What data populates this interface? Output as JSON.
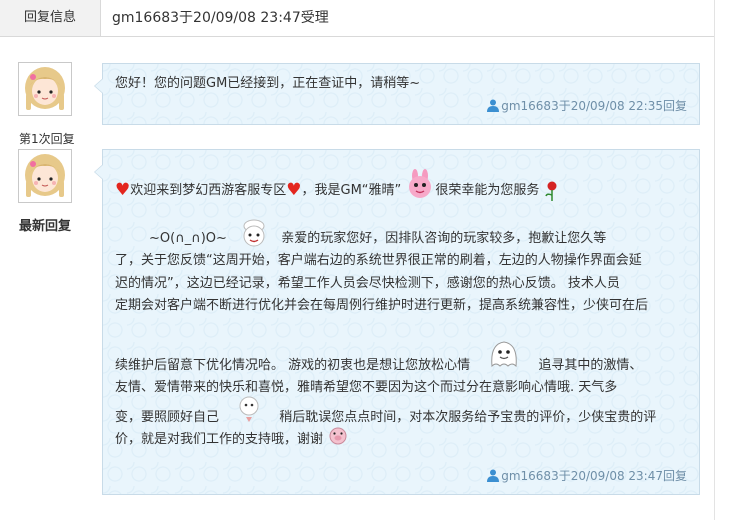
{
  "header": {
    "label": "回复信息",
    "value": "gm16683于20/09/08 23:47受理"
  },
  "replies": [
    {
      "side_label": "第1次回复",
      "text": "您好！您的问题GM已经接到，正在查证中，请稍等~",
      "meta": "gm16683于20/09/08 22:35回复"
    },
    {
      "side_label": "最新回复",
      "line1_a": "欢迎来到梦幻西游客服专区",
      "line1_b": "，我是GM“雅晴”",
      "line1_c": "很荣幸能为您服务",
      "line2_a": "~O(∩_∩)O~",
      "line2_b": "亲爱的玩家您好，因排队咨询的玩家较多，抱歉让您久等",
      "line3": "了，关于您反馈“这周开始，客户端右边的系统世界很正常的刷着，左边的人物操作界面会延",
      "line4": "迟的情况”，这边已经记录，希望工作人员会尽快检测下，感谢您的热心反馈。   技术人员",
      "line5": "定期会对客户端不断进行优化并会在每周例行维护时进行更新，提高系统兼容性，少侠可在后",
      "line6_a": "续维护后留意下优化情况哈。   游戏的初衷也是想让您放松心情",
      "line6_b": "追寻其中的激情、",
      "line7": "友情、爱情带来的快乐和喜悦，雅晴希望您不要因为这个而过分在意影响心情哦.   天气多",
      "line8_a": "变，要照顾好自己",
      "line8_b": "稍后耽误您点点时间，对本次服务给予宝贵的评价，少侠宝贵的评",
      "line9": "价，就是对我们工作的支持哦，谢谢",
      "meta": "gm16683于20/09/08 23:47回复"
    }
  ],
  "icons": {
    "user": "user-icon",
    "heart": "heart-icon",
    "rose": "rose-icon",
    "rabbit": "rabbit-emoticon-icon",
    "chef": "chef-emoticon-icon",
    "ghost": "ghost-emoticon-icon",
    "bubble_face": "bubble-emoticon-icon",
    "pig": "pig-emoticon-icon"
  },
  "colors": {
    "bubble_bg": "#e9f5fc",
    "bubble_border": "#c8dbe8",
    "meta_text": "#6f8fa8",
    "heart": "#e3261f"
  }
}
